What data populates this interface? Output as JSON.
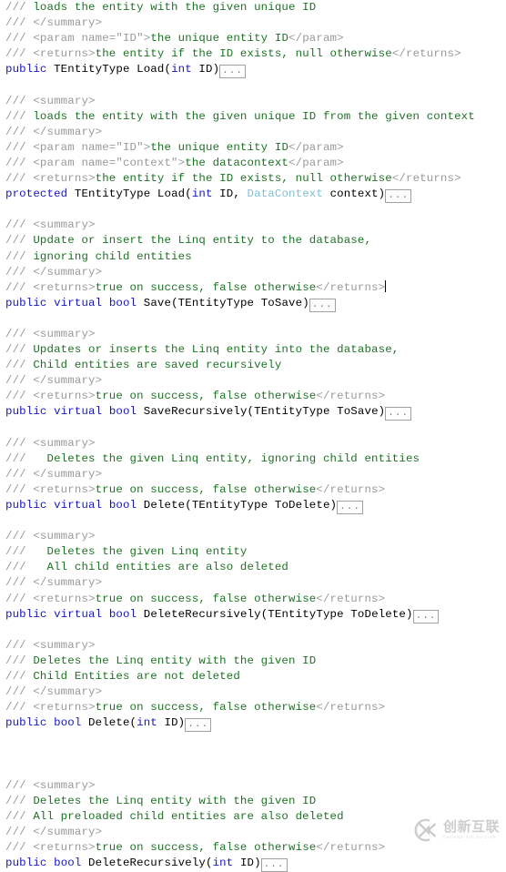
{
  "editor": {
    "language": "csharp",
    "background_color": "#ffffff",
    "colors": {
      "comment_slashes": "#9a9a9a",
      "comment_text": "#1d7324",
      "xml_tag": "#9a9a9a",
      "keyword": "#1515c8",
      "type": "#7fc0d8",
      "plain_text": "#000000",
      "ellipsis_border": "#a0a0a0",
      "caret": "#000000"
    },
    "collapsed_region_label": "...",
    "lines": [
      {
        "id": "l1",
        "segments": [
          {
            "t": "/// ",
            "k": "comment-mark"
          },
          {
            "t": "loads the entity with the given unique ID",
            "k": "comment"
          }
        ]
      },
      {
        "id": "l2",
        "segments": [
          {
            "t": "/// ",
            "k": "comment-mark"
          },
          {
            "t": "</summary>",
            "k": "xml"
          }
        ]
      },
      {
        "id": "l3",
        "segments": [
          {
            "t": "/// ",
            "k": "comment-mark"
          },
          {
            "t": "<param name=\"ID\">",
            "k": "xml"
          },
          {
            "t": "the unique entity ID",
            "k": "comment"
          },
          {
            "t": "</param>",
            "k": "xml"
          }
        ]
      },
      {
        "id": "l4",
        "segments": [
          {
            "t": "/// ",
            "k": "comment-mark"
          },
          {
            "t": "<returns>",
            "k": "xml"
          },
          {
            "t": "the entity if the ID exists, null otherwise",
            "k": "comment"
          },
          {
            "t": "</returns>",
            "k": "xml"
          }
        ]
      },
      {
        "id": "l5",
        "segments": [
          {
            "t": "public",
            "k": "keyword"
          },
          {
            "t": " TEntityType Load(",
            "k": "plain"
          },
          {
            "t": "int",
            "k": "keyword"
          },
          {
            "t": " ID)",
            "k": "plain"
          },
          {
            "t": "...",
            "k": "ellipsis"
          }
        ]
      },
      {
        "id": "l6",
        "segments": []
      },
      {
        "id": "l7",
        "segments": [
          {
            "t": "/// ",
            "k": "comment-mark"
          },
          {
            "t": "<summary>",
            "k": "xml"
          }
        ]
      },
      {
        "id": "l8",
        "segments": [
          {
            "t": "/// ",
            "k": "comment-mark"
          },
          {
            "t": "loads the entity with the given unique ID from the given context",
            "k": "comment"
          }
        ]
      },
      {
        "id": "l9",
        "segments": [
          {
            "t": "/// ",
            "k": "comment-mark"
          },
          {
            "t": "</summary>",
            "k": "xml"
          }
        ]
      },
      {
        "id": "l10",
        "segments": [
          {
            "t": "/// ",
            "k": "comment-mark"
          },
          {
            "t": "<param name=\"ID\">",
            "k": "xml"
          },
          {
            "t": "the unique entity ID",
            "k": "comment"
          },
          {
            "t": "</param>",
            "k": "xml"
          }
        ]
      },
      {
        "id": "l11",
        "segments": [
          {
            "t": "/// ",
            "k": "comment-mark"
          },
          {
            "t": "<param name=\"context\">",
            "k": "xml"
          },
          {
            "t": "the datacontext",
            "k": "comment"
          },
          {
            "t": "</param>",
            "k": "xml"
          }
        ]
      },
      {
        "id": "l12",
        "segments": [
          {
            "t": "/// ",
            "k": "comment-mark"
          },
          {
            "t": "<returns>",
            "k": "xml"
          },
          {
            "t": "the entity if the ID exists, null otherwise",
            "k": "comment"
          },
          {
            "t": "</returns>",
            "k": "xml"
          }
        ]
      },
      {
        "id": "l13",
        "segments": [
          {
            "t": "protected",
            "k": "keyword"
          },
          {
            "t": " TEntityType Load(",
            "k": "plain"
          },
          {
            "t": "int",
            "k": "keyword"
          },
          {
            "t": " ID, ",
            "k": "plain"
          },
          {
            "t": "DataContext",
            "k": "type"
          },
          {
            "t": " context)",
            "k": "plain"
          },
          {
            "t": "...",
            "k": "ellipsis"
          }
        ]
      },
      {
        "id": "l14",
        "segments": []
      },
      {
        "id": "l15",
        "segments": [
          {
            "t": "/// ",
            "k": "comment-mark"
          },
          {
            "t": "<summary>",
            "k": "xml"
          }
        ]
      },
      {
        "id": "l16",
        "segments": [
          {
            "t": "/// ",
            "k": "comment-mark"
          },
          {
            "t": "Update or insert the Linq entity to the database,",
            "k": "comment"
          }
        ]
      },
      {
        "id": "l17",
        "segments": [
          {
            "t": "/// ",
            "k": "comment-mark"
          },
          {
            "t": "ignoring child entities",
            "k": "comment"
          }
        ]
      },
      {
        "id": "l18",
        "segments": [
          {
            "t": "/// ",
            "k": "comment-mark"
          },
          {
            "t": "</summary>",
            "k": "xml"
          }
        ]
      },
      {
        "id": "l19",
        "caret_at_end": true,
        "segments": [
          {
            "t": "/// ",
            "k": "comment-mark"
          },
          {
            "t": "<returns>",
            "k": "xml"
          },
          {
            "t": "true on success, false otherwise",
            "k": "comment"
          },
          {
            "t": "</returns>",
            "k": "xml"
          }
        ]
      },
      {
        "id": "l20",
        "segments": [
          {
            "t": "public",
            "k": "keyword"
          },
          {
            "t": " ",
            "k": "plain"
          },
          {
            "t": "virtual",
            "k": "keyword"
          },
          {
            "t": " ",
            "k": "plain"
          },
          {
            "t": "bool",
            "k": "keyword"
          },
          {
            "t": " Save(TEntityType ToSave)",
            "k": "plain"
          },
          {
            "t": "...",
            "k": "ellipsis"
          }
        ]
      },
      {
        "id": "l21",
        "segments": []
      },
      {
        "id": "l22",
        "segments": [
          {
            "t": "/// ",
            "k": "comment-mark"
          },
          {
            "t": "<summary>",
            "k": "xml"
          }
        ]
      },
      {
        "id": "l23",
        "segments": [
          {
            "t": "/// ",
            "k": "comment-mark"
          },
          {
            "t": "Updates or inserts the Linq entity into the database,",
            "k": "comment"
          }
        ]
      },
      {
        "id": "l24",
        "segments": [
          {
            "t": "/// ",
            "k": "comment-mark"
          },
          {
            "t": "Child entities are saved recursively",
            "k": "comment"
          }
        ]
      },
      {
        "id": "l25",
        "segments": [
          {
            "t": "/// ",
            "k": "comment-mark"
          },
          {
            "t": "</summary>",
            "k": "xml"
          }
        ]
      },
      {
        "id": "l26",
        "segments": [
          {
            "t": "/// ",
            "k": "comment-mark"
          },
          {
            "t": "<returns>",
            "k": "xml"
          },
          {
            "t": "true on success, false otherwise",
            "k": "comment"
          },
          {
            "t": "</returns>",
            "k": "xml"
          }
        ]
      },
      {
        "id": "l27",
        "segments": [
          {
            "t": "public",
            "k": "keyword"
          },
          {
            "t": " ",
            "k": "plain"
          },
          {
            "t": "virtual",
            "k": "keyword"
          },
          {
            "t": " ",
            "k": "plain"
          },
          {
            "t": "bool",
            "k": "keyword"
          },
          {
            "t": " SaveRecursively(TEntityType ToSave)",
            "k": "plain"
          },
          {
            "t": "...",
            "k": "ellipsis"
          }
        ]
      },
      {
        "id": "l28",
        "segments": []
      },
      {
        "id": "l29",
        "segments": [
          {
            "t": "/// ",
            "k": "comment-mark"
          },
          {
            "t": "<summary>",
            "k": "xml"
          }
        ]
      },
      {
        "id": "l30",
        "segments": [
          {
            "t": "/// ",
            "k": "comment-mark"
          },
          {
            "t": "  Deletes the given Linq entity, ignoring child entities",
            "k": "comment"
          }
        ]
      },
      {
        "id": "l31",
        "segments": [
          {
            "t": "/// ",
            "k": "comment-mark"
          },
          {
            "t": "</summary>",
            "k": "xml"
          }
        ]
      },
      {
        "id": "l32",
        "segments": [
          {
            "t": "/// ",
            "k": "comment-mark"
          },
          {
            "t": "<returns>",
            "k": "xml"
          },
          {
            "t": "true on success, false otherwise",
            "k": "comment"
          },
          {
            "t": "</returns>",
            "k": "xml"
          }
        ]
      },
      {
        "id": "l33",
        "segments": [
          {
            "t": "public",
            "k": "keyword"
          },
          {
            "t": " ",
            "k": "plain"
          },
          {
            "t": "virtual",
            "k": "keyword"
          },
          {
            "t": " ",
            "k": "plain"
          },
          {
            "t": "bool",
            "k": "keyword"
          },
          {
            "t": " Delete(TEntityType ToDelete)",
            "k": "plain"
          },
          {
            "t": "...",
            "k": "ellipsis"
          }
        ]
      },
      {
        "id": "l34",
        "segments": []
      },
      {
        "id": "l35",
        "segments": [
          {
            "t": "/// ",
            "k": "comment-mark"
          },
          {
            "t": "<summary>",
            "k": "xml"
          }
        ]
      },
      {
        "id": "l36",
        "segments": [
          {
            "t": "/// ",
            "k": "comment-mark"
          },
          {
            "t": "  Deletes the given Linq entity",
            "k": "comment"
          }
        ]
      },
      {
        "id": "l37",
        "segments": [
          {
            "t": "/// ",
            "k": "comment-mark"
          },
          {
            "t": "  All child entities are also deleted",
            "k": "comment"
          }
        ]
      },
      {
        "id": "l38",
        "segments": [
          {
            "t": "/// ",
            "k": "comment-mark"
          },
          {
            "t": "</summary>",
            "k": "xml"
          }
        ]
      },
      {
        "id": "l39",
        "segments": [
          {
            "t": "/// ",
            "k": "comment-mark"
          },
          {
            "t": "<returns>",
            "k": "xml"
          },
          {
            "t": "true on success, false otherwise",
            "k": "comment"
          },
          {
            "t": "</returns>",
            "k": "xml"
          }
        ]
      },
      {
        "id": "l40",
        "segments": [
          {
            "t": "public",
            "k": "keyword"
          },
          {
            "t": " ",
            "k": "plain"
          },
          {
            "t": "virtual",
            "k": "keyword"
          },
          {
            "t": " ",
            "k": "plain"
          },
          {
            "t": "bool",
            "k": "keyword"
          },
          {
            "t": " DeleteRecursively(TEntityType ToDelete)",
            "k": "plain"
          },
          {
            "t": "...",
            "k": "ellipsis"
          }
        ]
      },
      {
        "id": "l41",
        "segments": []
      },
      {
        "id": "l42",
        "segments": [
          {
            "t": "/// ",
            "k": "comment-mark"
          },
          {
            "t": "<summary>",
            "k": "xml"
          }
        ]
      },
      {
        "id": "l43",
        "segments": [
          {
            "t": "/// ",
            "k": "comment-mark"
          },
          {
            "t": "Deletes the Linq entity with the given ID",
            "k": "comment"
          }
        ]
      },
      {
        "id": "l44",
        "segments": [
          {
            "t": "/// ",
            "k": "comment-mark"
          },
          {
            "t": "Child Entities are not deleted",
            "k": "comment"
          }
        ]
      },
      {
        "id": "l45",
        "segments": [
          {
            "t": "/// ",
            "k": "comment-mark"
          },
          {
            "t": "</summary>",
            "k": "xml"
          }
        ]
      },
      {
        "id": "l46",
        "segments": [
          {
            "t": "/// ",
            "k": "comment-mark"
          },
          {
            "t": "<returns>",
            "k": "xml"
          },
          {
            "t": "true on success, false otherwise",
            "k": "comment"
          },
          {
            "t": "</returns>",
            "k": "xml"
          }
        ]
      },
      {
        "id": "l47",
        "segments": [
          {
            "t": "public",
            "k": "keyword"
          },
          {
            "t": " ",
            "k": "plain"
          },
          {
            "t": "bool",
            "k": "keyword"
          },
          {
            "t": " Delete(",
            "k": "plain"
          },
          {
            "t": "int",
            "k": "keyword"
          },
          {
            "t": " ID)",
            "k": "plain"
          },
          {
            "t": "...",
            "k": "ellipsis"
          }
        ]
      },
      {
        "id": "l48",
        "segments": []
      },
      {
        "id": "l49",
        "segments": []
      },
      {
        "id": "l50",
        "segments": []
      },
      {
        "id": "l51",
        "segments": [
          {
            "t": "/// ",
            "k": "comment-mark"
          },
          {
            "t": "<summary>",
            "k": "xml"
          }
        ]
      },
      {
        "id": "l52",
        "segments": [
          {
            "t": "/// ",
            "k": "comment-mark"
          },
          {
            "t": "Deletes the Linq entity with the given ID",
            "k": "comment"
          }
        ]
      },
      {
        "id": "l53",
        "segments": [
          {
            "t": "/// ",
            "k": "comment-mark"
          },
          {
            "t": "All preloaded child entities are also deleted",
            "k": "comment"
          }
        ]
      },
      {
        "id": "l54",
        "segments": [
          {
            "t": "/// ",
            "k": "comment-mark"
          },
          {
            "t": "</summary>",
            "k": "xml"
          }
        ]
      },
      {
        "id": "l55",
        "segments": [
          {
            "t": "/// ",
            "k": "comment-mark"
          },
          {
            "t": "<returns>",
            "k": "xml"
          },
          {
            "t": "true on success, false otherwise",
            "k": "comment"
          },
          {
            "t": "</returns>",
            "k": "xml"
          }
        ]
      },
      {
        "id": "l56",
        "segments": [
          {
            "t": "public",
            "k": "keyword"
          },
          {
            "t": " ",
            "k": "plain"
          },
          {
            "t": "bool",
            "k": "keyword"
          },
          {
            "t": " DeleteRecursively(",
            "k": "plain"
          },
          {
            "t": "int",
            "k": "keyword"
          },
          {
            "t": " ID)",
            "k": "plain"
          },
          {
            "t": "...",
            "k": "ellipsis"
          }
        ]
      }
    ]
  },
  "watermark": {
    "logo_glyph": "X",
    "chinese_text": "创新互联",
    "pinyin_text": "CHUANG XIN HU LIAN"
  }
}
